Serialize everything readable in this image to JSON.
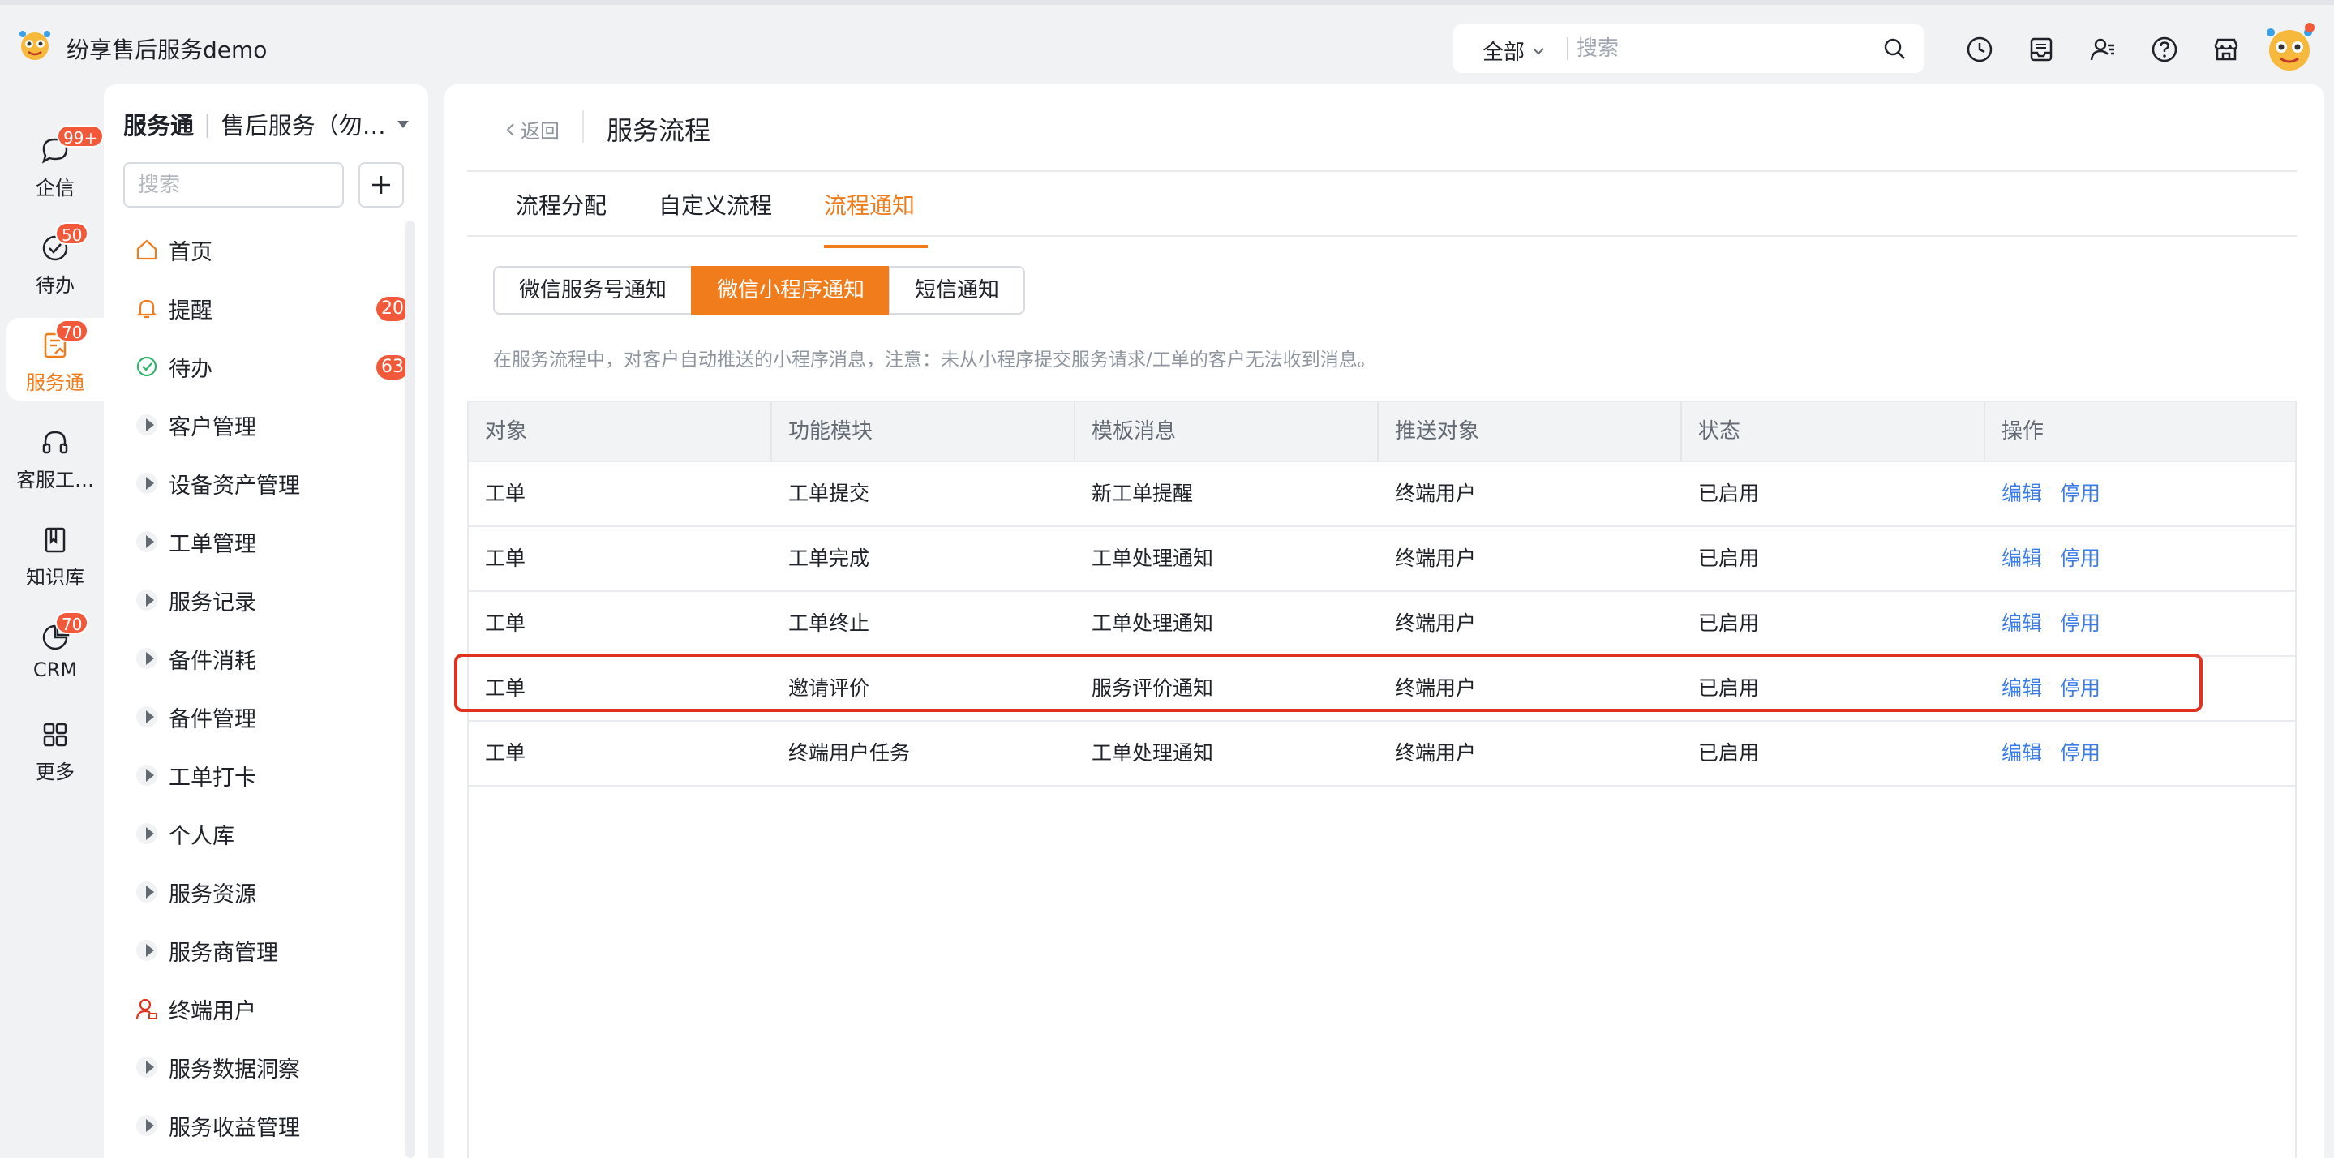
{
  "app": {
    "title": "纷享售后服务demo"
  },
  "topbar": {
    "scope": "全部",
    "search_placeholder": "搜索",
    "icons": [
      "clock-icon",
      "inbox-icon",
      "contacts-icon",
      "help-icon",
      "store-icon"
    ]
  },
  "rail": {
    "items": [
      {
        "label": "企信",
        "badge": "99+",
        "icon": "chat-icon"
      },
      {
        "label": "待办",
        "badge": "50",
        "icon": "check-circle-icon"
      },
      {
        "label": "服务通",
        "badge": "70",
        "icon": "service-icon",
        "active": true
      },
      {
        "label": "客服工…",
        "badge": "",
        "icon": "headset-icon"
      },
      {
        "label": "知识库",
        "badge": "",
        "icon": "book-icon"
      },
      {
        "label": "CRM",
        "badge": "70",
        "icon": "pie-icon"
      },
      {
        "label": "更多",
        "badge": "",
        "icon": "grid-icon"
      }
    ]
  },
  "sidebar": {
    "title": "服务通",
    "subtitle": "售后服务（勿…",
    "search_placeholder": "搜索",
    "items": [
      {
        "label": "首页",
        "icon": "home-icon"
      },
      {
        "label": "提醒",
        "icon": "bell-icon",
        "badge": "20"
      },
      {
        "label": "待办",
        "icon": "check-icon",
        "badge": "63"
      },
      {
        "label": "客户管理",
        "icon": "expand-icon"
      },
      {
        "label": "设备资产管理",
        "icon": "expand-icon"
      },
      {
        "label": "工单管理",
        "icon": "expand-icon"
      },
      {
        "label": "服务记录",
        "icon": "expand-icon"
      },
      {
        "label": "备件消耗",
        "icon": "expand-icon"
      },
      {
        "label": "备件管理",
        "icon": "expand-icon"
      },
      {
        "label": "工单打卡",
        "icon": "expand-icon"
      },
      {
        "label": "个人库",
        "icon": "expand-icon"
      },
      {
        "label": "服务资源",
        "icon": "expand-icon"
      },
      {
        "label": "服务商管理",
        "icon": "expand-icon"
      },
      {
        "label": "终端用户",
        "icon": "user-icon"
      },
      {
        "label": "服务数据洞察",
        "icon": "expand-icon"
      },
      {
        "label": "服务收益管理",
        "icon": "expand-icon"
      }
    ]
  },
  "main": {
    "back_label": "返回",
    "title": "服务流程",
    "tabs": [
      "流程分配",
      "自定义流程",
      "流程通知"
    ],
    "active_tab": 2,
    "segments": [
      "微信服务号通知",
      "微信小程序通知",
      "短信通知"
    ],
    "active_segment": 1,
    "hint": "在服务流程中，对客户自动推送的小程序消息，注意：未从小程序提交服务请求/工单的客户无法收到消息。",
    "table": {
      "columns": [
        "对象",
        "功能模块",
        "模板消息",
        "推送对象",
        "状态",
        "操作"
      ],
      "rows": [
        [
          "工单",
          "工单提交",
          "新工单提醒",
          "终端用户",
          "已启用"
        ],
        [
          "工单",
          "工单完成",
          "工单处理通知",
          "终端用户",
          "已启用"
        ],
        [
          "工单",
          "工单终止",
          "工单处理通知",
          "终端用户",
          "已启用"
        ],
        [
          "工单",
          "邀请评价",
          "服务评价通知",
          "终端用户",
          "已启用"
        ],
        [
          "工单",
          "终端用户任务",
          "工单处理通知",
          "终端用户",
          "已启用"
        ]
      ],
      "actions": [
        "编辑",
        "停用"
      ],
      "highlighted_row": 3
    }
  }
}
